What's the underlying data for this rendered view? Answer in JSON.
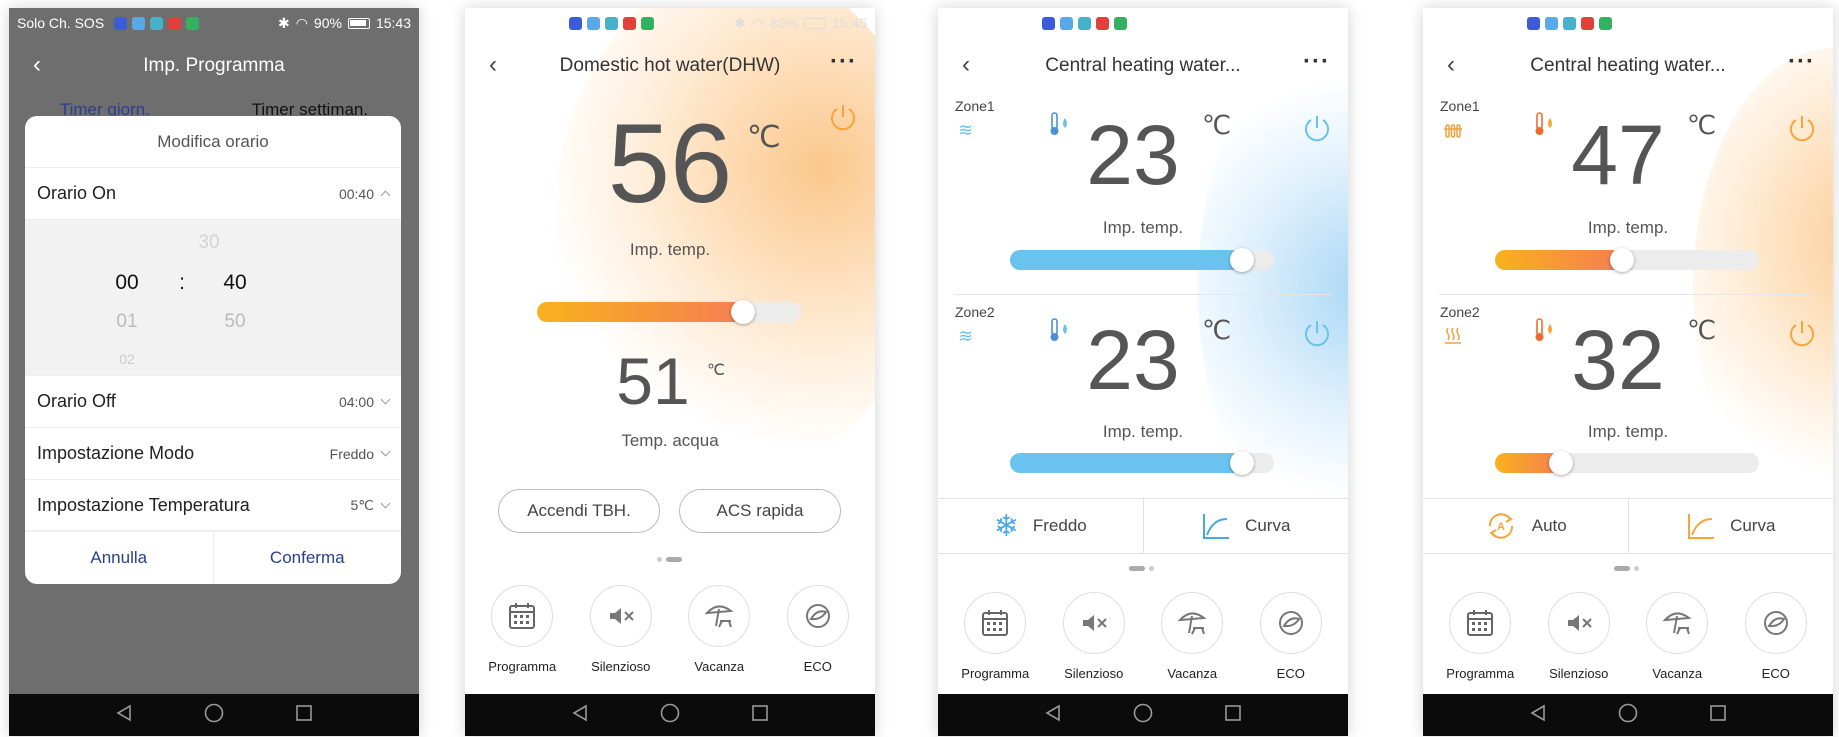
{
  "screen1": {
    "status": {
      "carrier": "Solo Ch. SOS",
      "battery": "90%",
      "time": "15:43"
    },
    "title": "Imp. Programma",
    "tabs": [
      "Timer giorn.",
      "Timer settiman."
    ],
    "dialog": {
      "title": "Modifica orario",
      "on_label": "Orario On",
      "on_value": "00:40",
      "picker": {
        "hours": [
          "00",
          "01",
          "02"
        ],
        "minutes": [
          "30",
          "40",
          "50"
        ],
        "sep": ":"
      },
      "off_label": "Orario Off",
      "off_value": "04:00",
      "mode_label": "Impostazione Modo",
      "mode_value": "Freddo",
      "temp_label": "Impostazione Temperatura",
      "temp_value": "5℃",
      "cancel": "Annulla",
      "confirm": "Conferma"
    }
  },
  "screen2": {
    "status": {
      "battery": "89%",
      "time": "15:45"
    },
    "title": "Domestic hot water(DHW)",
    "set_temp": "56",
    "unit": "℃",
    "set_label": "Imp. temp.",
    "slider_level": 0.78,
    "water_temp": "51",
    "water_unit": "℃",
    "water_label": "Temp. acqua",
    "btn_tbh": "Accendi TBH.",
    "btn_acs": "ACS rapida"
  },
  "screen3": {
    "title": "Central heating water...",
    "zone1": {
      "name": "Zone1",
      "temp": "23",
      "unit": "℃",
      "label": "Imp. temp.",
      "level": 0.88
    },
    "zone2": {
      "name": "Zone2",
      "temp": "23",
      "unit": "℃",
      "label": "Imp. temp.",
      "level": 0.88
    },
    "mode_left": "Freddo",
    "mode_right": "Curva"
  },
  "screen4": {
    "title": "Central heating water...",
    "zone1": {
      "name": "Zone1",
      "temp": "47",
      "unit": "℃",
      "label": "Imp. temp.",
      "level": 0.48
    },
    "zone2": {
      "name": "Zone2",
      "temp": "32",
      "unit": "℃",
      "label": "Imp. temp.",
      "level": 0.25
    },
    "mode_left": "Auto",
    "mode_right": "Curva"
  },
  "bottom_icons": [
    "Programma",
    "Silenzioso",
    "Vacanza",
    "ECO"
  ],
  "colors": {
    "orange": "#f7a53a",
    "blue": "#69c3ee",
    "accent_blue": "#2b3e8f"
  }
}
